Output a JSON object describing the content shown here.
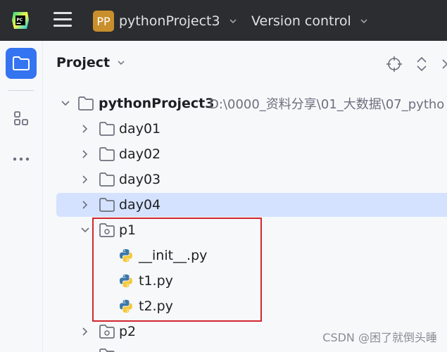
{
  "topbar": {
    "app_logo_text": "PC",
    "project_badge": "PP",
    "project_name": "pythonProject3",
    "vcs_label": "Version control"
  },
  "panel": {
    "title": "Project"
  },
  "tree": {
    "root": {
      "label": "pythonProject3",
      "path": "D:\\0000_资料分享\\01_大数据\\07_pytho"
    },
    "items": [
      {
        "label": "day01"
      },
      {
        "label": "day02"
      },
      {
        "label": "day03"
      },
      {
        "label": "day04"
      },
      {
        "label": "p1"
      },
      {
        "label": "__init__.py"
      },
      {
        "label": "t1.py"
      },
      {
        "label": "t2.py"
      },
      {
        "label": "p2"
      }
    ]
  },
  "watermark": "CSDN @困了就倒头睡",
  "colors": {
    "topbar_bg": "#2b2d30",
    "accent": "#3574f0",
    "selection": "#d4e2ff",
    "highlight_border": "#d3262f",
    "folder_stroke": "#6c707e"
  }
}
